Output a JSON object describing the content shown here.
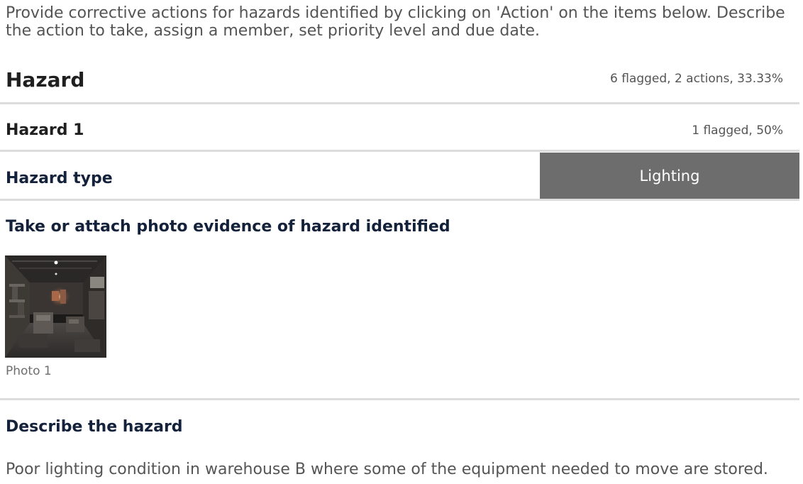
{
  "instructions": "Provide corrective actions for hazards identified by clicking on 'Action' on the items below. Describe the action to take, assign a member, set priority level and due date.",
  "section": {
    "title": "Hazard",
    "stats": "6 flagged, 2 actions, 33.33%"
  },
  "subsection": {
    "title": "Hazard 1",
    "stats": "1 flagged, 50%"
  },
  "questions": {
    "hazard_type": {
      "label": "Hazard type",
      "answer": "Lighting",
      "answer_color": "#6d6d6d"
    },
    "photo_evidence": {
      "label": "Take or attach photo evidence of hazard identified",
      "photos": [
        {
          "caption": "Photo 1"
        }
      ]
    },
    "description": {
      "label": "Describe the hazard",
      "answer": "Poor lighting condition in warehouse B where some of the equipment needed to move are stored."
    }
  }
}
